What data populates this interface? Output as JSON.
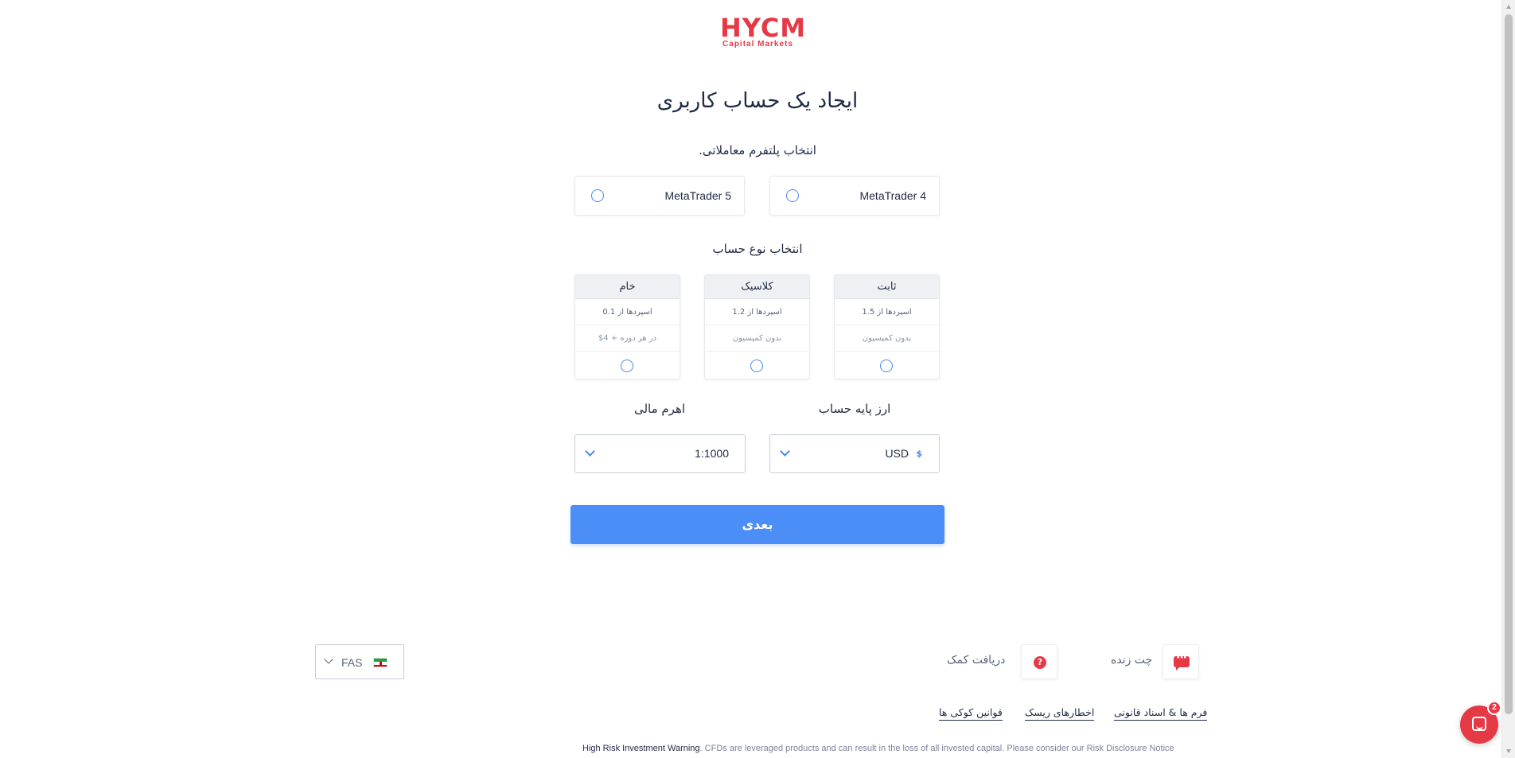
{
  "brand": {
    "logo_text": "HYCM",
    "logo_sub": "Capital Markets",
    "accent_color": "#e63946",
    "primary_color": "#4c8ef7"
  },
  "page": {
    "title": "ایجاد یک حساب کاربری"
  },
  "platform": {
    "label": "انتخاب پلتفرم معاملاتی.",
    "options": [
      {
        "label": "MetaTrader 4",
        "selected": false
      },
      {
        "label": "MetaTrader 5",
        "selected": false
      }
    ]
  },
  "account_type": {
    "label": "انتخاب نوع حساب",
    "cards": [
      {
        "name": "ثابت",
        "spread": "اسپردها از 1.5",
        "commission": "بدون کمیسیون",
        "selected": false
      },
      {
        "name": "کلاسیک",
        "spread": "اسپردها از 1.2",
        "commission": "بدون کمیسیون",
        "selected": false
      },
      {
        "name": "خام",
        "spread": "اسپردها از 0.1",
        "commission": "در هر دوره + 4$",
        "selected": false
      }
    ]
  },
  "base_currency": {
    "label": "ارز پایه حساب",
    "value": "USD",
    "icon_symbol": "$"
  },
  "leverage": {
    "label": "اهرم مالی",
    "value": "1:1000"
  },
  "next_button": {
    "label": "بعدی"
  },
  "footer": {
    "language": {
      "code": "FAS",
      "flag": "iran-flag-icon"
    },
    "live_chat": "چت زنده",
    "get_help": "دریافت کمک",
    "links": [
      "فرم ها & اسناد قانونی",
      "اخطارهای ریسک",
      "قوانین کوکی ها"
    ],
    "disclaimer_strong": "High Risk Investment Warning",
    "disclaimer_text": ". CFDs are leveraged products and can result in the loss of all invested capital. Please consider our Risk Disclosure Notice"
  },
  "messenger": {
    "badge_count": "2"
  }
}
